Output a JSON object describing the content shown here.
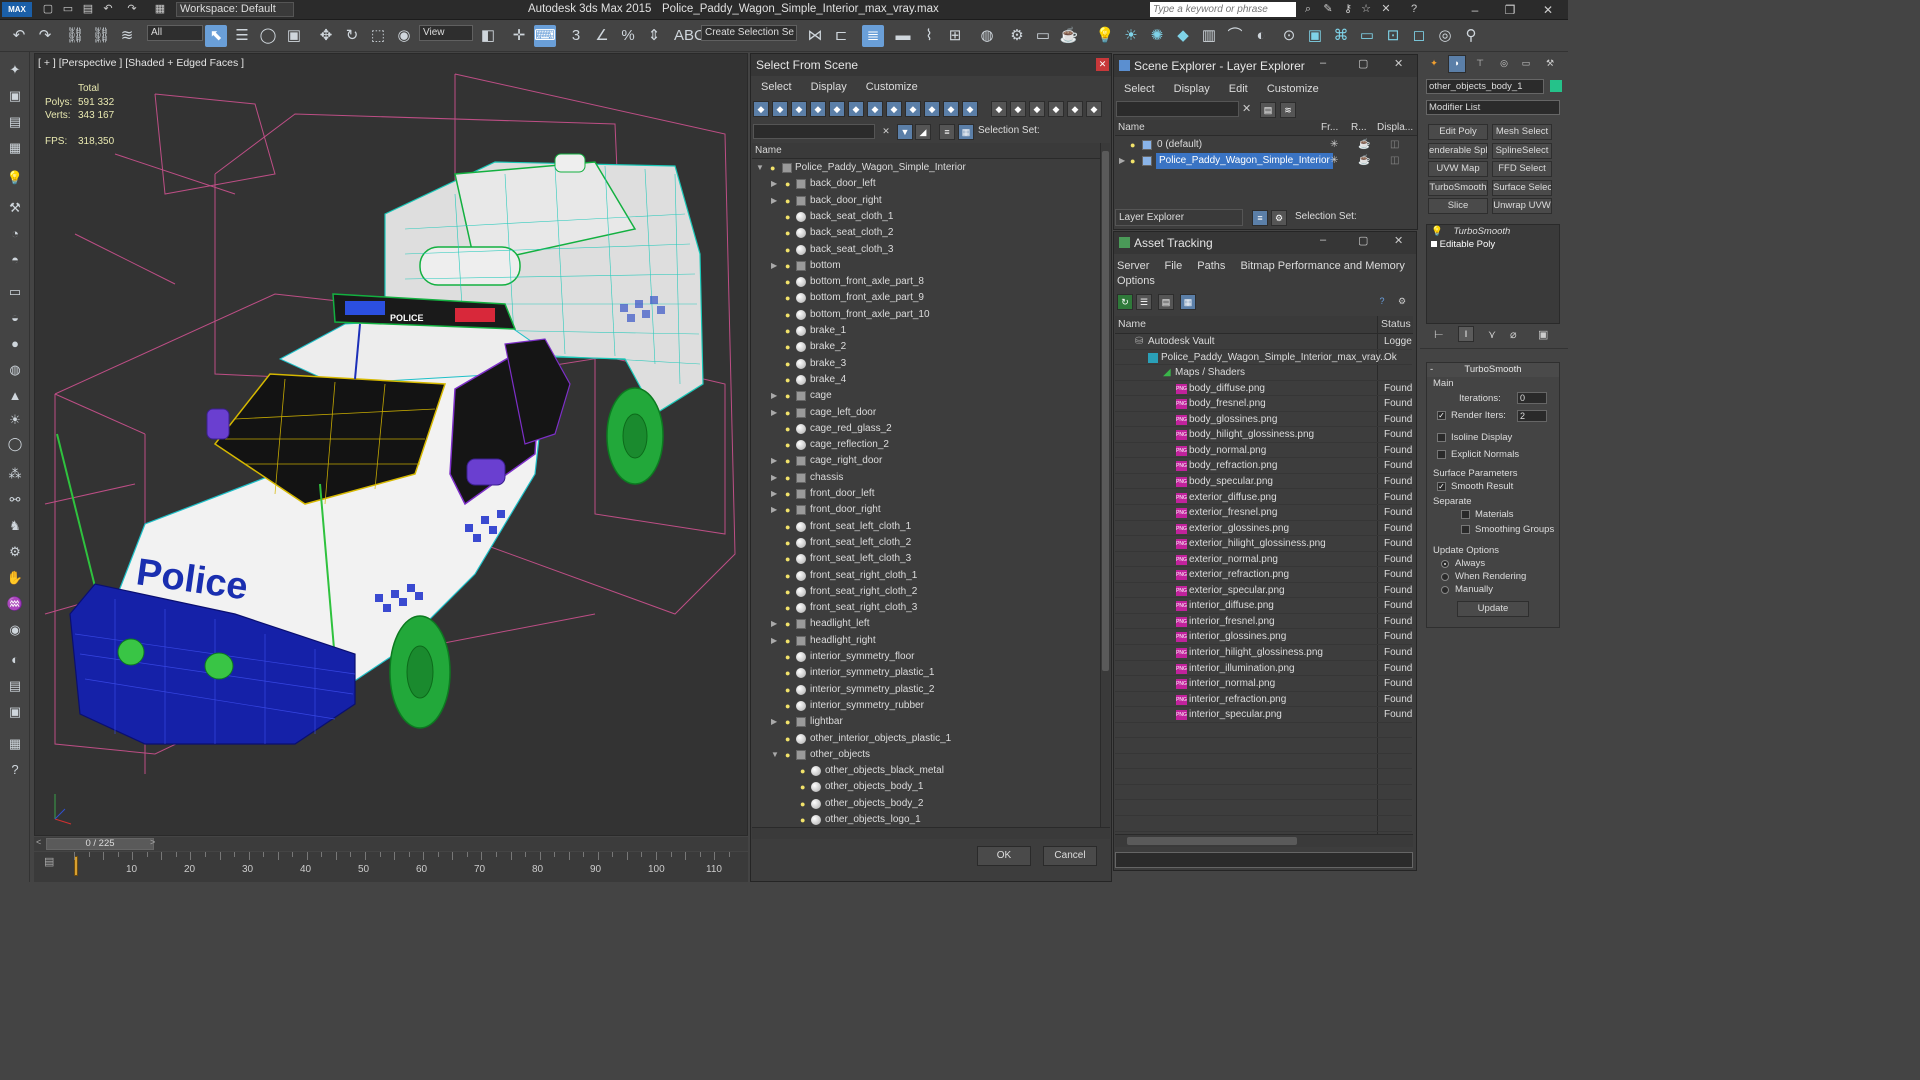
{
  "app": {
    "logo": "MAX",
    "title": "Autodesk 3ds Max  2015",
    "file": "Police_Paddy_Wagon_Simple_Interior_max_vray.max",
    "workspace": "Workspace: Default",
    "search_placeholder": "Type a keyword or phrase"
  },
  "toolbar": {
    "selection_filter": "All",
    "ref_coord": "View",
    "named_selection": "Create Selection Se"
  },
  "viewport": {
    "label": "[ + ] [Perspective ] [Shaded + Edged Faces ]",
    "stats": {
      "total_label": "Total",
      "polys_label": "Polys:",
      "polys": "591 332",
      "verts_label": "Verts:",
      "verts": "343 167",
      "fps_label": "FPS:",
      "fps": "318,350"
    },
    "decal_text": "Police",
    "lightbar_text": "POLICE"
  },
  "timeline": {
    "frame": "0 / 225",
    "ticks": [
      "10",
      "20",
      "30",
      "40",
      "50",
      "60",
      "70",
      "80",
      "90",
      "100",
      "110"
    ]
  },
  "select_from_scene": {
    "title": "Select From Scene",
    "menu": [
      "Select",
      "Display",
      "Customize"
    ],
    "selection_set_label": "Selection Set:",
    "col_name": "Name",
    "root": "Police_Paddy_Wagon_Simple_Interior",
    "items": [
      {
        "name": "back_door_left",
        "group": true
      },
      {
        "name": "back_door_right",
        "group": true
      },
      {
        "name": "back_seat_cloth_1",
        "group": false
      },
      {
        "name": "back_seat_cloth_2",
        "group": false
      },
      {
        "name": "back_seat_cloth_3",
        "group": false
      },
      {
        "name": "bottom",
        "group": true
      },
      {
        "name": "bottom_front_axle_part_8",
        "group": false
      },
      {
        "name": "bottom_front_axle_part_9",
        "group": false
      },
      {
        "name": "bottom_front_axle_part_10",
        "group": false
      },
      {
        "name": "brake_1",
        "group": false
      },
      {
        "name": "brake_2",
        "group": false
      },
      {
        "name": "brake_3",
        "group": false
      },
      {
        "name": "brake_4",
        "group": false
      },
      {
        "name": "cage",
        "group": true
      },
      {
        "name": "cage_left_door",
        "group": true
      },
      {
        "name": "cage_red_glass_2",
        "group": false
      },
      {
        "name": "cage_reflection_2",
        "group": false
      },
      {
        "name": "cage_right_door",
        "group": true
      },
      {
        "name": "chassis",
        "group": true
      },
      {
        "name": "front_door_left",
        "group": true
      },
      {
        "name": "front_door_right",
        "group": true
      },
      {
        "name": "front_seat_left_cloth_1",
        "group": false
      },
      {
        "name": "front_seat_left_cloth_2",
        "group": false
      },
      {
        "name": "front_seat_left_cloth_3",
        "group": false
      },
      {
        "name": "front_seat_right_cloth_1",
        "group": false
      },
      {
        "name": "front_seat_right_cloth_2",
        "group": false
      },
      {
        "name": "front_seat_right_cloth_3",
        "group": false
      },
      {
        "name": "headlight_left",
        "group": true
      },
      {
        "name": "headlight_right",
        "group": true
      },
      {
        "name": "interior_symmetry_floor",
        "group": false
      },
      {
        "name": "interior_symmetry_plastic_1",
        "group": false
      },
      {
        "name": "interior_symmetry_plastic_2",
        "group": false
      },
      {
        "name": "interior_symmetry_rubber",
        "group": false
      },
      {
        "name": "lightbar",
        "group": true
      },
      {
        "name": "other_interior_objects_plastic_1",
        "group": false
      },
      {
        "name": "other_objects",
        "group": true,
        "open": true
      }
    ],
    "sub_items": [
      "other_objects_black_metal",
      "other_objects_body_1",
      "other_objects_body_2",
      "other_objects_logo_1"
    ],
    "ok": "OK",
    "cancel": "Cancel"
  },
  "scene_explorer": {
    "title": "Scene Explorer - Layer Explorer",
    "menu": [
      "Select",
      "Display",
      "Edit",
      "Customize"
    ],
    "cols": [
      "Name",
      "Fr...",
      "R...",
      "Displa..."
    ],
    "layers": [
      "0 (default)",
      "Police_Paddy_Wagon_Simple_Interior"
    ],
    "footer_dropdown": "Layer Explorer",
    "selection_set_label": "Selection Set:"
  },
  "asset_tracking": {
    "title": "Asset Tracking",
    "menu": [
      "Server",
      "File",
      "Paths",
      "Bitmap Performance and Memory",
      "Options"
    ],
    "cols": [
      "Name",
      "Status"
    ],
    "vault": "Autodesk Vault",
    "vault_status": "Logge",
    "file": "Police_Paddy_Wagon_Simple_Interior_max_vray...",
    "file_status": "Ok",
    "maps_label": "Maps / Shaders",
    "maps": [
      "body_diffuse.png",
      "body_fresnel.png",
      "body_glossines.png",
      "body_hilight_glossiness.png",
      "body_normal.png",
      "body_refraction.png",
      "body_specular.png",
      "exterior_diffuse.png",
      "exterior_fresnel.png",
      "exterior_glossines.png",
      "exterior_hilight_glossiness.png",
      "exterior_normal.png",
      "exterior_refraction.png",
      "exterior_specular.png",
      "interior_diffuse.png",
      "interior_fresnel.png",
      "interior_glossines.png",
      "interior_hilight_glossiness.png",
      "interior_illumination.png",
      "interior_normal.png",
      "interior_refraction.png",
      "interior_specular.png"
    ],
    "found": "Found"
  },
  "command_panel": {
    "object_name": "other_objects_body_1",
    "modifier_list": "Modifier List",
    "buttons": [
      "Edit Poly",
      "Mesh Select",
      "enderable Splir",
      "SplineSelect",
      "UVW Map",
      "FFD Select",
      "TurboSmooth",
      "Surface Select",
      "Slice",
      "Unwrap UVW"
    ],
    "stack": [
      "TurboSmooth",
      "Editable Poly"
    ],
    "rollout": "TurboSmooth",
    "main": "Main",
    "iterations_label": "Iterations:",
    "iterations": "0",
    "render_iters_label": "Render Iters:",
    "render_iters": "2",
    "isoline": "Isoline Display",
    "explicit": "Explicit Normals",
    "surface_params": "Surface Parameters",
    "smooth_result": "Smooth Result",
    "separate": "Separate",
    "materials": "Materials",
    "smoothing_groups": "Smoothing Groups",
    "update_options": "Update Options",
    "always": "Always",
    "when_rendering": "When Rendering",
    "manually": "Manually",
    "update": "Update"
  },
  "colors": {
    "selection_blue": "#3a74c4",
    "found_text": "#dcdcdc",
    "png_badge": "#c1229c"
  }
}
